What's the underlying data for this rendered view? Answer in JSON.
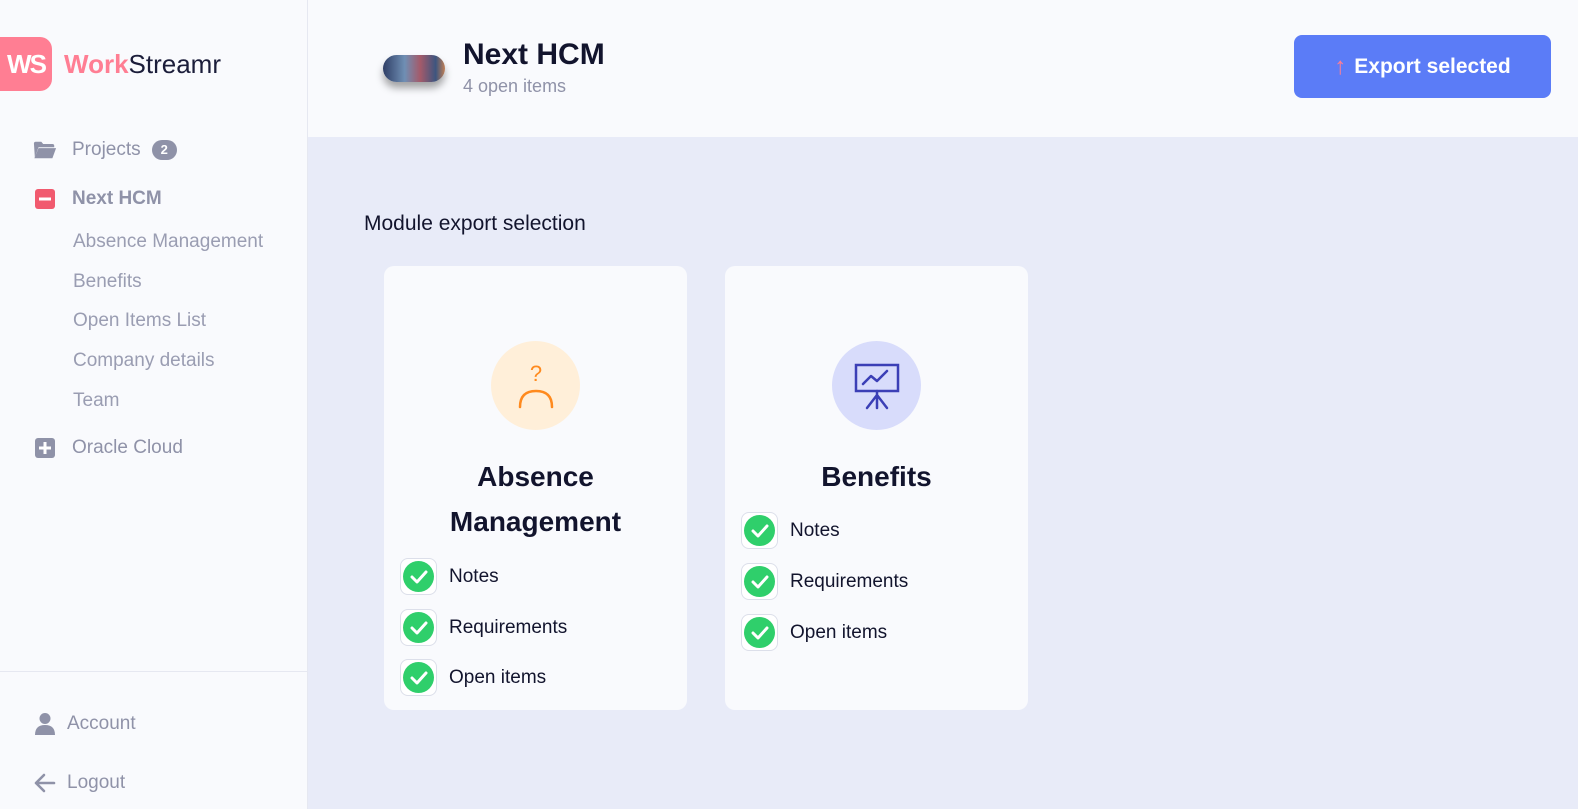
{
  "brand": {
    "mark": "WS",
    "name_part1": "Work",
    "name_part2": "Streamr"
  },
  "sidebar": {
    "projects_label": "Projects",
    "projects_count": "2",
    "active_project": "Next HCM",
    "sub_items": [
      "Absence Management",
      "Benefits",
      "Open Items List",
      "Company details",
      "Team"
    ],
    "other_project": "Oracle Cloud",
    "account_label": "Account",
    "logout_label": "Logout"
  },
  "header": {
    "title": "Next HCM",
    "subtitle": "4 open items",
    "export_label": "Export selected"
  },
  "main": {
    "section_title": "Module export selection",
    "cards": [
      {
        "title_line1": "Absence",
        "title_line2": "Management",
        "icon": "person-question-icon",
        "items": [
          "Notes",
          "Requirements",
          "Open items"
        ],
        "checked": [
          true,
          true,
          true
        ]
      },
      {
        "title_line1": "Benefits",
        "icon": "presentation-chart-icon",
        "items": [
          "Notes",
          "Requirements",
          "Open items"
        ],
        "checked": [
          true,
          true,
          true
        ]
      }
    ]
  },
  "colors": {
    "accent": "#5b7cf7",
    "brand": "#ff7e93",
    "check": "#2fcf6b",
    "main_bg": "#e8ebf8"
  }
}
